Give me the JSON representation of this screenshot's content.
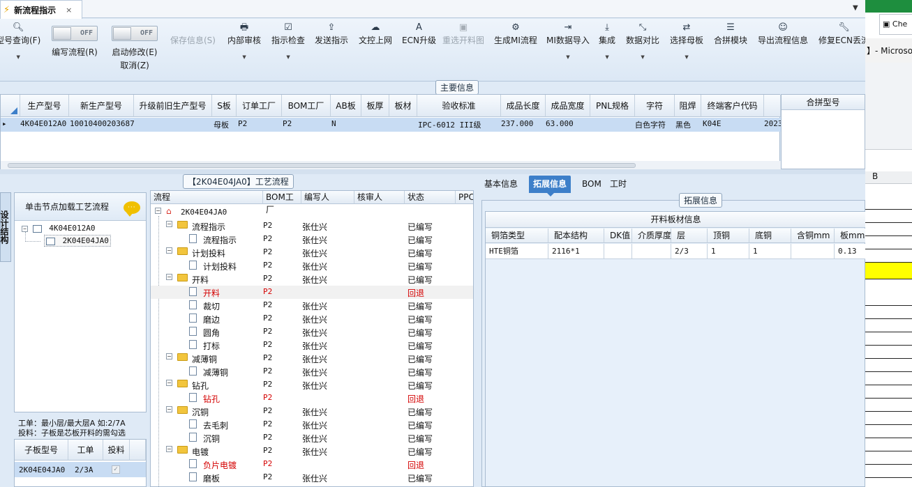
{
  "tab": {
    "title": "新流程指示",
    "close": "×"
  },
  "ribbon": {
    "query": "型号查询(F)",
    "write_flow": "编写流程(R)",
    "start_modify": "启动修改(E)",
    "cancel": "取消(Z)",
    "toggle_off": "OFF",
    "save": "保存信息(S)",
    "internal_review": "内部审核",
    "check": "指示检查",
    "send": "发送指示",
    "upload": "文控上网",
    "ecn": "ECN升级",
    "reselect": "重选开料图",
    "gen_mi": "生成MI流程",
    "mi_import": "MI数据导入",
    "integrate": "集成",
    "compare": "数据对比",
    "select_master": "选择母板",
    "merge": "合拼模块",
    "export": "导出流程信息",
    "fix_ecn": "修复ECN丢流"
  },
  "main_caption": "主要信息",
  "main_grid": {
    "headers": [
      "生产型号",
      "新生产型号",
      "升级前旧生产型号",
      "S板",
      "订单工厂",
      "BOM工厂",
      "AB板",
      "板厚",
      "板材",
      "验收标准",
      "成品长度",
      "成品宽度",
      "PNL规格",
      "字符",
      "阻焊",
      "终端客户代码"
    ],
    "row": {
      "prod": "4K04E012A0",
      "newprod": "10010400203687",
      "s": "母板",
      "order": "P2",
      "bom": "P2",
      "ab": "N",
      "std": "IPC-6012 III级",
      "len": "237.000",
      "wid": "63.000",
      "char": "白色字符",
      "mask": "黑色",
      "cust": "K04E",
      "extra": "2023"
    },
    "right_header": "合拼型号"
  },
  "side_tab": "设计结构",
  "left_panel": {
    "head": "单击节点加载工艺流程",
    "root": "4K04E012A0",
    "child": "2K04E04JA0",
    "note1": "工单：最小层/最大层A 如:2/7A",
    "note2": "投料：子板是芯板开料的需勾选",
    "sub_headers": [
      "子板型号",
      "工单",
      "投料"
    ],
    "sub_row": {
      "model": "2K04E04JA0",
      "order": "2/3A",
      "check": "✓"
    }
  },
  "process": {
    "caption": "【2K04E04JA0】工艺流程",
    "headers": [
      "流程",
      "BOM工厂",
      "编写人",
      "核审人",
      "状态",
      "PPC"
    ],
    "root": "2K04E04JA0",
    "rows": [
      {
        "name": "流程指示",
        "bom": "P2",
        "writer": "张仕兴",
        "status": "已编写"
      },
      {
        "name": "流程指示",
        "bom": "P2",
        "writer": "张仕兴",
        "status": "已编写"
      },
      {
        "name": "计划投料",
        "bom": "P2",
        "writer": "张仕兴",
        "status": "已编写"
      },
      {
        "name": "计划投料",
        "bom": "P2",
        "writer": "张仕兴",
        "status": "已编写"
      },
      {
        "name": "开料",
        "bom": "P2",
        "writer": "张仕兴",
        "status": "已编写"
      },
      {
        "name": "开料",
        "bom": "P2",
        "writer": "",
        "status": "回退"
      },
      {
        "name": "裁切",
        "bom": "P2",
        "writer": "张仕兴",
        "status": "已编写"
      },
      {
        "name": "磨边",
        "bom": "P2",
        "writer": "张仕兴",
        "status": "已编写"
      },
      {
        "name": "圆角",
        "bom": "P2",
        "writer": "张仕兴",
        "status": "已编写"
      },
      {
        "name": "打标",
        "bom": "P2",
        "writer": "张仕兴",
        "status": "已编写"
      },
      {
        "name": "减薄铜",
        "bom": "P2",
        "writer": "张仕兴",
        "status": "已编写"
      },
      {
        "name": "减薄铜",
        "bom": "P2",
        "writer": "张仕兴",
        "status": "已编写"
      },
      {
        "name": "钻孔",
        "bom": "P2",
        "writer": "张仕兴",
        "status": "已编写"
      },
      {
        "name": "钻孔",
        "bom": "P2",
        "writer": "",
        "status": "回退"
      },
      {
        "name": "沉铜",
        "bom": "P2",
        "writer": "张仕兴",
        "status": "已编写"
      },
      {
        "name": "去毛刺",
        "bom": "P2",
        "writer": "张仕兴",
        "status": "已编写"
      },
      {
        "name": "沉铜",
        "bom": "P2",
        "writer": "张仕兴",
        "status": "已编写"
      },
      {
        "name": "电镀",
        "bom": "P2",
        "writer": "张仕兴",
        "status": "已编写"
      },
      {
        "name": "负片电镀",
        "bom": "P2",
        "writer": "",
        "status": "回退"
      },
      {
        "name": "磨板",
        "bom": "P2",
        "writer": "张仕兴",
        "status": "已编写"
      }
    ]
  },
  "detail_tabs": [
    "基本信息",
    "拓展信息",
    "BOM",
    "工时"
  ],
  "ext_caption": "拓展信息",
  "ext_table": {
    "title": "开料板材信息",
    "headers": [
      "铜箔类型",
      "配本结构",
      "DK值",
      "介质厚度",
      "层",
      "顶铜",
      "底铜",
      "含铜mm",
      "板mm"
    ],
    "row": [
      "HTE铜箔",
      "2116*1",
      "",
      "",
      "2/3",
      "1",
      "1",
      "",
      "0.13"
    ]
  },
  "background_window": {
    "tab": "Che",
    "title": "】- Microso",
    "col": "B"
  }
}
